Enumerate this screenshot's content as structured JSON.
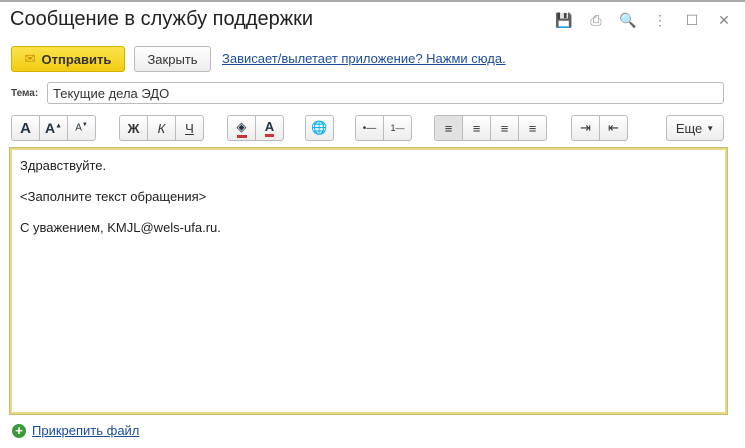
{
  "window": {
    "title": "Сообщение в службу поддержки",
    "icons": [
      "save-icon",
      "print-icon",
      "preview-icon",
      "more-icon",
      "maximize-icon",
      "close-icon"
    ]
  },
  "actions": {
    "send_label": "Отправить",
    "close_label": "Закрыть",
    "help_link": "Зависает/вылетает приложение? Нажми сюда."
  },
  "subject": {
    "label": "Тема:",
    "value": "Текущие дела ЭДО"
  },
  "toolbar": {
    "font": "A",
    "bold": "Ж",
    "italic": "К",
    "underline": "Ч",
    "font_color": "A",
    "more": "Еще"
  },
  "editor": {
    "lines": [
      "Здравствуйте.",
      "<Заполните текст обращения>",
      "С уважением, KMJL@wels-ufa.ru."
    ]
  },
  "attach": {
    "label": "Прикрепить файл"
  }
}
